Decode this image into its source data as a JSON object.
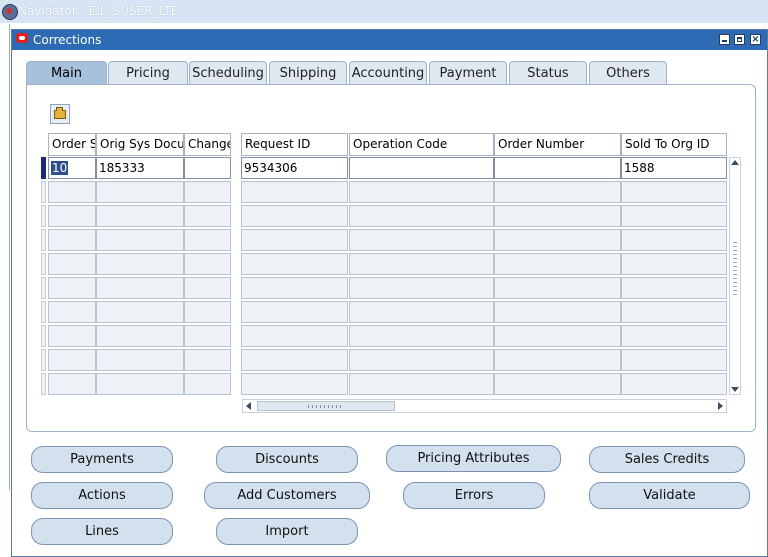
{
  "navigator": {
    "title": "Navigator - EIL_SUSER_LTE"
  },
  "window": {
    "title": "Corrections"
  },
  "tabs": [
    {
      "label": "Main",
      "active": true
    },
    {
      "label": "Pricing"
    },
    {
      "label": "Scheduling"
    },
    {
      "label": "Shipping"
    },
    {
      "label": "Accounting"
    },
    {
      "label": "Payment"
    },
    {
      "label": "Status"
    },
    {
      "label": "Others"
    }
  ],
  "grid": {
    "columns": [
      "Order S",
      "Orig Sys Docu",
      "Change",
      "Request ID",
      "Operation Code",
      "Order Number",
      "Sold To Org ID"
    ],
    "rows": [
      [
        "10",
        "185333",
        "",
        "9534306",
        "",
        "",
        "1588"
      ]
    ],
    "empty_rows": 9
  },
  "buttons": {
    "payments": "Payments",
    "discounts": "Discounts",
    "pricing_attributes": "Pricing Attributes",
    "sales_credits": "Sales Credits",
    "actions": "Actions",
    "add_customers": "Add Customers",
    "errors": "Errors",
    "validate": "Validate",
    "lines": "Lines",
    "import": "Import"
  },
  "colors": {
    "title_bar": "#2d6cb4",
    "active_tab": "#a7c0dc",
    "button": "#d3e0ee"
  },
  "icons": [
    "navigator-icon",
    "oracle-icon",
    "minimize-icon",
    "maximize-icon",
    "close-icon",
    "open-folder-icon"
  ]
}
